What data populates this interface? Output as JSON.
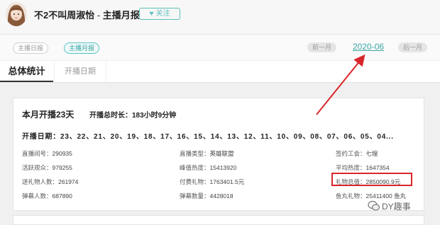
{
  "header": {
    "streamer_name": "不2不叫周淑怡",
    "separator": " - ",
    "page_label": "主播月报",
    "follow_label": "关注",
    "heart_icon": "heart-icon"
  },
  "subnav": {
    "daily_report": "主播日报",
    "monthly_report": "主播月报",
    "prev_month": "前一月",
    "current_month": "2020-06",
    "next_month": "后一月"
  },
  "tabs": [
    {
      "label": "总体统计",
      "active": true
    },
    {
      "label": "开播日期",
      "active": false
    }
  ],
  "summary": {
    "title": "本月开播23天",
    "duration_label": "开播总时长：",
    "duration_value": "183小时9分钟",
    "days_label": "开播日期：",
    "days_value": "23、22、21、20、19、18、17、16、15、14、13、12、11、10、09、08、07、06、05、04..."
  },
  "stats": {
    "col1": [
      {
        "label": "直播间号：",
        "value": "290935"
      },
      {
        "label": "活跃观众：",
        "value": "979255"
      },
      {
        "label": "送礼物人数：",
        "value": "261974"
      },
      {
        "label": "弹幕人数：",
        "value": "687890"
      }
    ],
    "col2": [
      {
        "label": "直播类型：",
        "value": "英雄联盟"
      },
      {
        "label": "峰值热度：",
        "value": "15413920"
      },
      {
        "label": "付费礼物：",
        "value": "1763401.5元"
      },
      {
        "label": "弹幕数量：",
        "value": "4428018"
      }
    ],
    "col3": [
      {
        "label": "签约工会：",
        "value": "七煌"
      },
      {
        "label": "平均热度：",
        "value": "1647354"
      },
      {
        "label": "礼物总值：",
        "value": "2850090.9元"
      },
      {
        "label": "鱼丸礼物：",
        "value": "25411400 鱼丸"
      }
    ]
  },
  "annotations": {
    "highlight_color": "#d9262b",
    "accent_color": "#5bc0be"
  },
  "watermark": {
    "text": "DY趣事",
    "icon": "wechat-icon"
  }
}
